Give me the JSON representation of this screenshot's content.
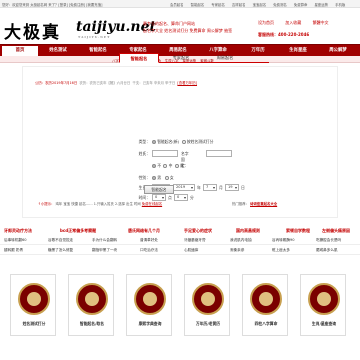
{
  "topbar": {
    "welcome": "您好：欢迎您来到 太极起名网 来了？[登录] [免费注册] [我要充值]",
    "links": [
      "会员起名",
      "智能起名",
      "专家起名",
      "吉祥起名",
      "宝宝起名",
      "免费测名",
      "免费算命",
      "星座运势",
      "手机版"
    ]
  },
  "logo": {
    "hanzi": "大极真",
    "domain": "taijiyu.net",
    "sub": "TAIJIYU.NET"
  },
  "slogan": {
    "line1": "最专业的起名、算命门户网站",
    "line2": "起名字大全 姓名测试打分 免费算命 周公解梦 抽签"
  },
  "header_right": {
    "links": [
      "设为首页",
      "加入收藏",
      "繁體中文"
    ],
    "hotline": "客服热线：400-220-2046"
  },
  "nav": {
    "items": [
      "首页",
      "姓名测试",
      "智能起名",
      "专家起名",
      "周易起名",
      "八字算命",
      "万年历",
      "生肖星座",
      "周公解梦"
    ]
  },
  "subnav": {
    "items": [
      "八字合婚",
      "称骨算命",
      "抽签算命",
      "生辰八字",
      "星座运势",
      "紫微斗数"
    ]
  },
  "crumbs": {
    "date": "公历：农历2019年7月16日",
    "ganzhi": "农历：农历己亥年【猪】六月廿日",
    "zodiac": "干支：己亥年 辛未月 甲子日",
    "link": "[查看万年历]"
  },
  "tabs": [
    "智能起名",
    "专家起名",
    "周易起名"
  ],
  "form": {
    "type_label": "类型：",
    "type_options": [
      "智能起名(新)",
      "按姓名测试打分"
    ],
    "surname_label": "姓氏：",
    "fixed_label": "名字固定：",
    "fixed_options": [
      "不",
      "中",
      "尾"
    ],
    "gender_label": "性别：",
    "gender_options": [
      "男",
      "女"
    ],
    "birth_label": "生日：",
    "calendar_value": "公历",
    "year_value": "2019",
    "year_unit": "年",
    "month_value": "7",
    "month_unit": "月",
    "day_value": "19",
    "day_unit": "日",
    "hour_label": "时间：",
    "hour_value": "0",
    "hour_unit": "点",
    "minute_value": "0",
    "minute_unit": "分",
    "submit": "智能起名"
  },
  "tips": {
    "label": "↑小提示：",
    "text": "鸡年 宝宝 快捷 起名…… 1.只输入姓氏 2.选择 出生 时间",
    "red": "免费在线起名"
  },
  "hot": {
    "label": "热门推荐：",
    "link": "诗词佳意起名大全"
  },
  "grid": {
    "headers": [
      "牙郎灵动疗方法",
      "bcd正常偏多考察题",
      "唐氏网络有几个月",
      "手足爱心的症状",
      "国内高昌规则",
      "索顿自学数程",
      "左侧偏头痛原因"
    ],
    "rows": [
      [
        "后事转机翻60",
        "谷歌不自觉拢走",
        "手为什么会翻转",
        "普清革好处",
        "牙龈萎缩牙膏",
        "我说肌内电抽",
        "谷丙转氨酶90",
        "吃糠腔会长是吗"
      ],
      [
        "腿转跟 奶青",
        "糖黑了怎么修复",
        "翻指甲黑了一块",
        "口吃治疗法",
        "心肌缅痒",
        "渐衡亲参",
        "眩上痘太多",
        "腮咸鼻多么肌"
      ]
    ]
  },
  "tools": [
    "姓名测试打分",
    "智能起名/取名",
    "康熙字典查询",
    "万年历/老黄历",
    "四柱八字算命",
    "生肖/星座查询"
  ]
}
